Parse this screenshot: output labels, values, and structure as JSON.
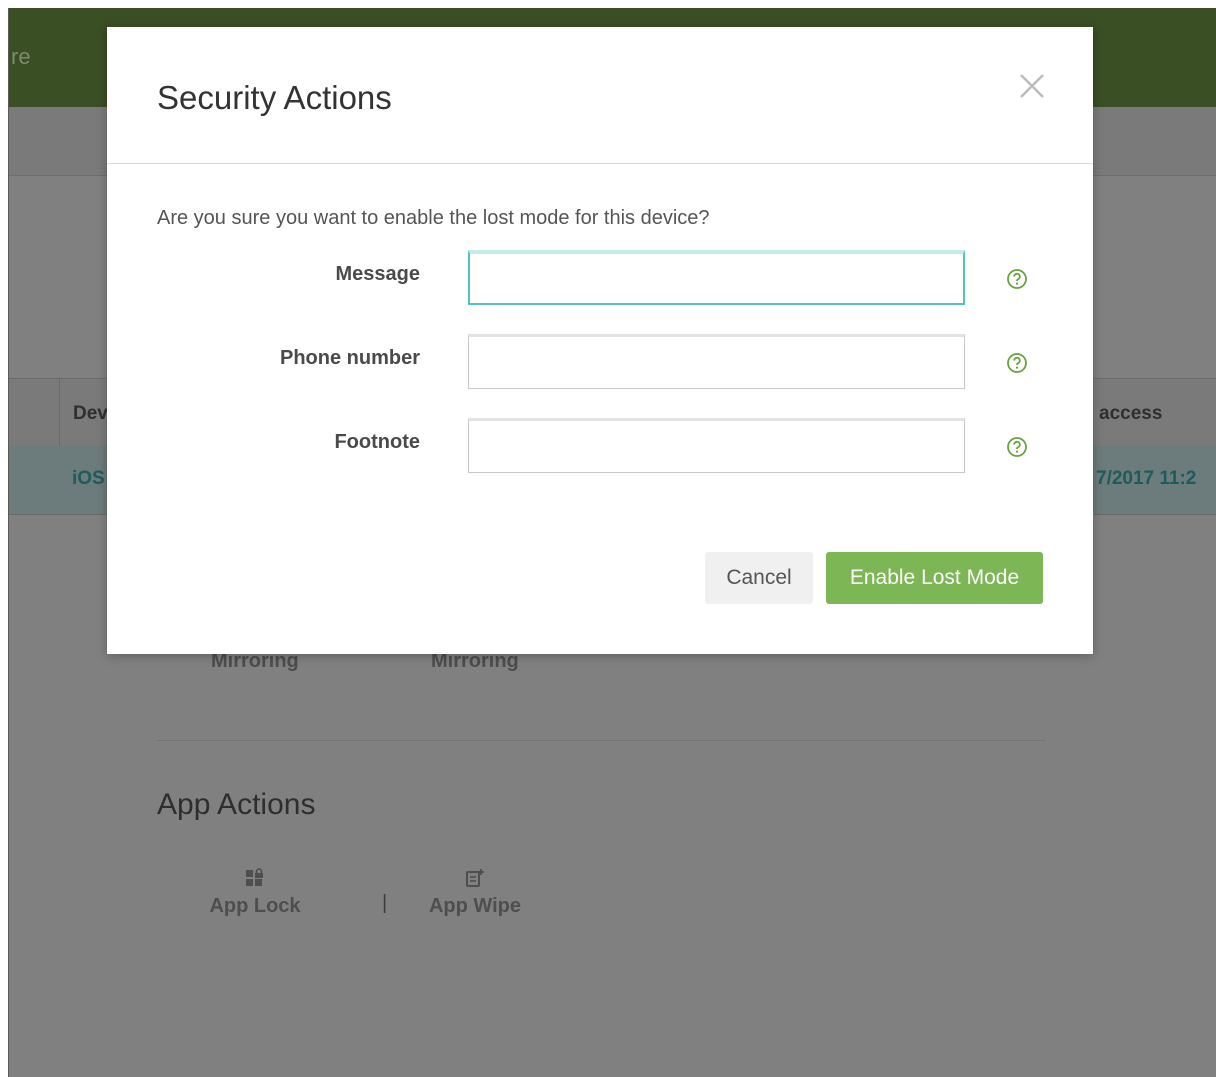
{
  "background": {
    "header_brand_fragment": "re",
    "table": {
      "col_device_fragment": "Dev",
      "col_access_fragment": "access",
      "row_platform_fragment": "iOS",
      "row_date_fragment": "7/2017 11:2"
    },
    "mirroring_labels": [
      "Mirroring",
      "Mirroring"
    ],
    "app_actions": {
      "title": "App Actions",
      "items": [
        {
          "label": "App Lock",
          "icon": "app-lock-icon"
        },
        {
          "label": "App Wipe",
          "icon": "app-wipe-icon"
        }
      ],
      "separator": "|"
    }
  },
  "modal": {
    "title": "Security Actions",
    "close_icon": "close-icon",
    "question": "Are you sure you want to enable the lost mode for this device?",
    "fields": [
      {
        "label": "Message",
        "value": "",
        "focused": true,
        "help_icon": "help-icon"
      },
      {
        "label": "Phone number",
        "value": "",
        "focused": false,
        "help_icon": "help-icon"
      },
      {
        "label": "Footnote",
        "value": "",
        "focused": false,
        "help_icon": "help-icon"
      }
    ],
    "buttons": {
      "cancel": "Cancel",
      "confirm": "Enable Lost Mode"
    }
  },
  "colors": {
    "accent_green": "#7cb655",
    "header_green": "#3a4f24",
    "focus_teal": "#4fc4c1",
    "overlay_gray": "#808080"
  }
}
